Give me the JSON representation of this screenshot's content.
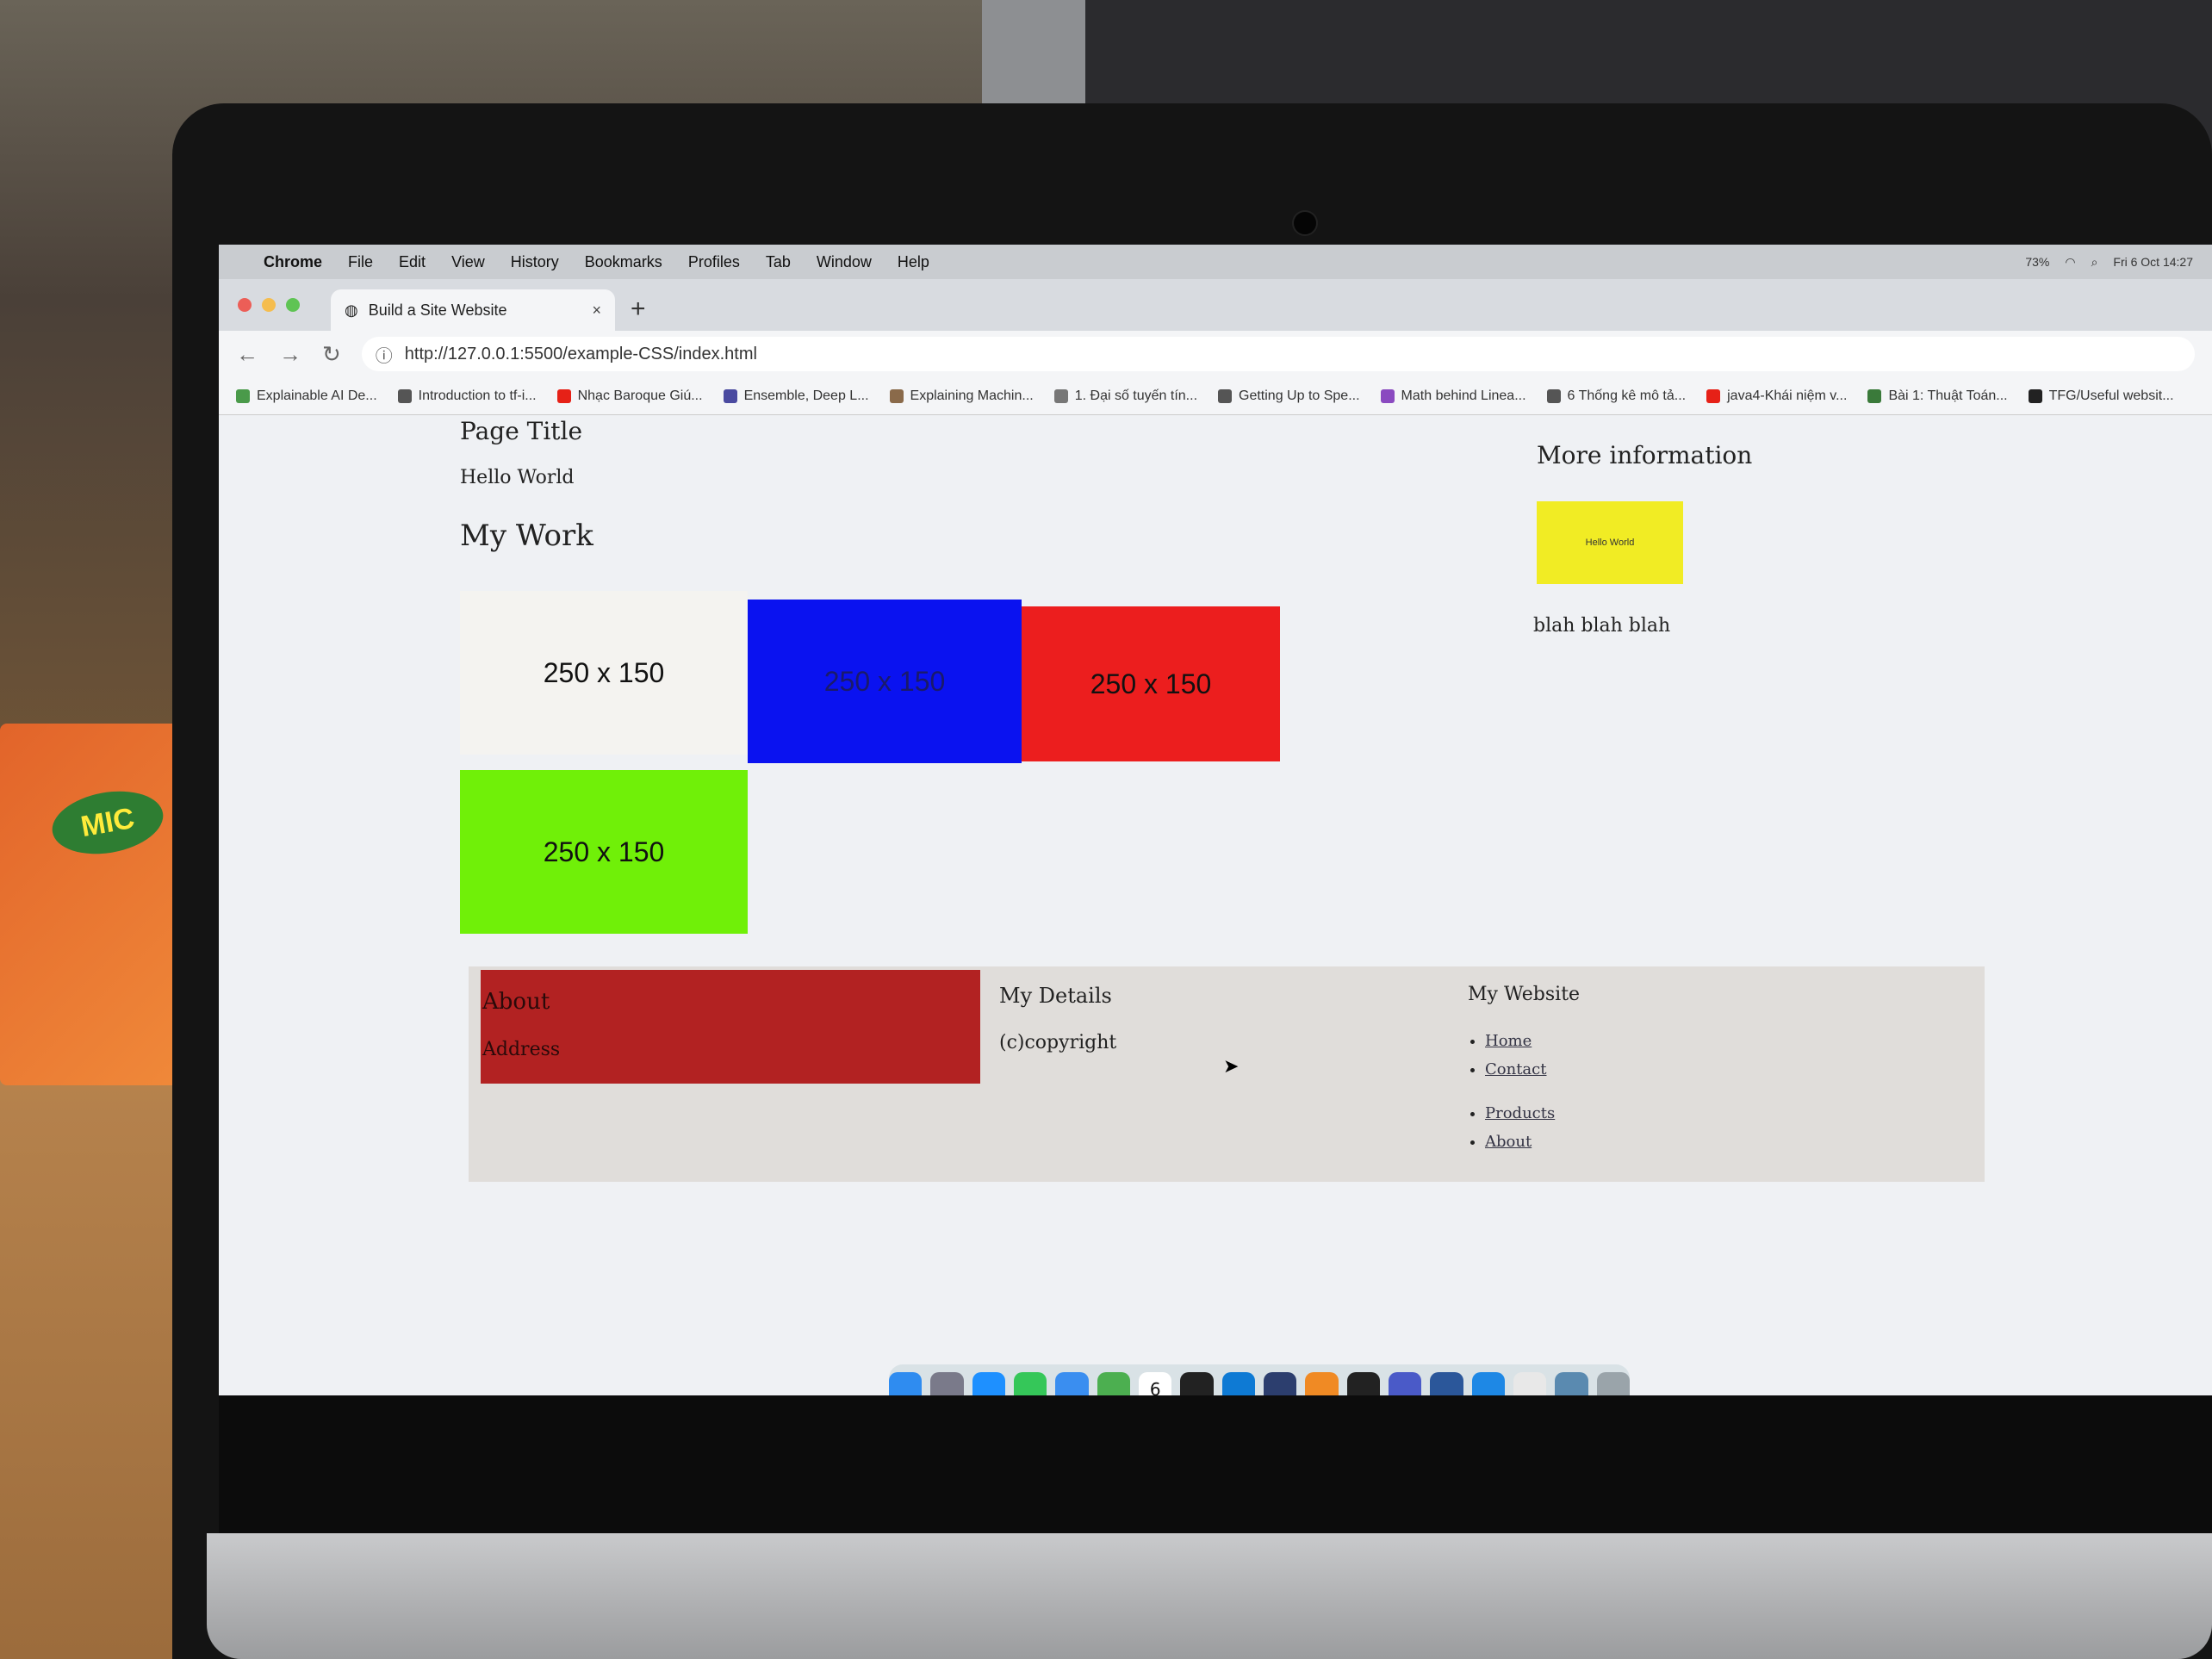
{
  "menubar": {
    "app_name": "Chrome",
    "items": [
      "File",
      "Edit",
      "View",
      "History",
      "Bookmarks",
      "Profiles",
      "Tab",
      "Window",
      "Help"
    ],
    "battery": "73%",
    "datetime": "Fri 6 Oct  14:27"
  },
  "browser": {
    "tab_title": "Build a Site Website",
    "url": "http://127.0.0.1:5500/example-CSS/index.html",
    "bookmarks": [
      {
        "label": "Explainable AI De...",
        "color": "#4a9a4a"
      },
      {
        "label": "Introduction to tf-i...",
        "color": "#555555"
      },
      {
        "label": "Nhạc Baroque Giú...",
        "color": "#e62117"
      },
      {
        "label": "Ensemble, Deep L...",
        "color": "#4a4aa0"
      },
      {
        "label": "Explaining Machin...",
        "color": "#8a6a4a"
      },
      {
        "label": "1. Đại số tuyến tín...",
        "color": "#777777"
      },
      {
        "label": "Getting Up to Spe...",
        "color": "#555555"
      },
      {
        "label": "Math behind Linea...",
        "color": "#8a4ac0"
      },
      {
        "label": "6 Thống kê mô tả...",
        "color": "#555555"
      },
      {
        "label": "java4-Khái niệm v...",
        "color": "#e62117"
      },
      {
        "label": "Bài 1: Thuật Toán...",
        "color": "#3a7a3a"
      },
      {
        "label": "TFG/Useful websit...",
        "color": "#222222"
      }
    ]
  },
  "webpage": {
    "page_title": "Page Title",
    "hello": "Hello World",
    "my_work": "My Work",
    "boxes": [
      "250 x 150",
      "250 x 150",
      "250 x 150",
      "250 x 150"
    ],
    "more_information": "More information",
    "yellow_box": "Hello World",
    "blah": "blah blah blah",
    "footer": {
      "about": "About",
      "address": "Address",
      "my_details": "My Details",
      "copyright": "(c)copyright",
      "my_website": "My Website",
      "links": [
        "Home",
        "Contact",
        "Products",
        "About"
      ]
    }
  },
  "colors": {
    "blue_box": "#0a12f0",
    "red_box": "#ec1e1e",
    "green_box": "#70f008",
    "yellow_box": "#f1ec24",
    "footer_about": "#b22222"
  },
  "dock": {
    "icons": [
      "finder-icon",
      "launchpad-icon",
      "safari-icon",
      "messages-icon",
      "mail-icon",
      "maps-icon",
      "calendar-icon",
      "terminal-icon",
      "vscode-icon",
      "oxford-dictionary-icon",
      "books-icon",
      "github-icon",
      "teams-icon",
      "word-icon",
      "zalo-icon",
      "chrome-icon",
      "preview-icon",
      "trash-icon"
    ],
    "calendar_day": "6"
  }
}
